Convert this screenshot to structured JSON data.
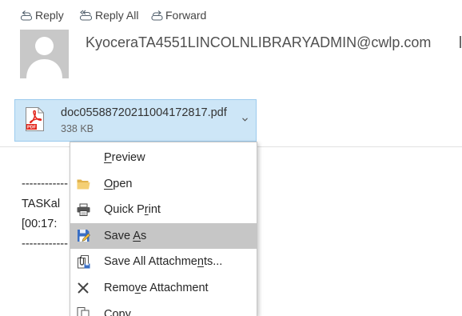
{
  "toolbar": {
    "actions": [
      {
        "label": "Reply",
        "icon": "reply-icon"
      },
      {
        "label": "Reply All",
        "icon": "reply-all-icon"
      },
      {
        "label": "Forward",
        "icon": "forward-icon"
      }
    ]
  },
  "message": {
    "avatar_icon": "contact-placeholder-icon",
    "sender_address": "KyoceraTA4551LINCOLNLIBRARYADMIN@cwlp.com",
    "attachment": {
      "icon": "pdf-file-icon",
      "icon_label": "PDF",
      "file_name": "doc05588720211004172817.pdf",
      "file_size": "338 KB",
      "menu_icon": "chevron-down-icon",
      "selected": true
    },
    "body_lines": [
      "------------",
      "TASKal",
      "[00:17:",
      "------------"
    ]
  },
  "context_menu": {
    "items": [
      {
        "label": "Preview",
        "access_key": "P",
        "icon": null,
        "highlighted": false
      },
      {
        "label": "Open",
        "access_key": "O",
        "icon": "folder-open-icon",
        "highlighted": false
      },
      {
        "label": "Quick Print",
        "access_key": "r",
        "icon": "printer-icon",
        "highlighted": false
      },
      {
        "label": "Save As",
        "access_key": "A",
        "icon": "save-as-icon",
        "highlighted": true
      },
      {
        "label": "Save All Attachments...",
        "access_key": "n",
        "icon": "save-all-attachments-icon",
        "highlighted": false
      },
      {
        "label": "Remove Attachment",
        "access_key": "v",
        "icon": "remove-icon",
        "highlighted": false
      },
      {
        "label": "Copy",
        "access_key": "C",
        "icon": "copy-icon",
        "highlighted": false
      }
    ]
  },
  "colors": {
    "text": "#444444",
    "icon": "#52606d",
    "avatar_bg": "#c8c8c8",
    "attachment_selected_bg": "#cde6f7",
    "attachment_selected_border": "#9ccbee",
    "pdf_red": "#e2261c",
    "menu_border": "#c6c6c6",
    "menu_highlight": "#c6c6c6"
  }
}
